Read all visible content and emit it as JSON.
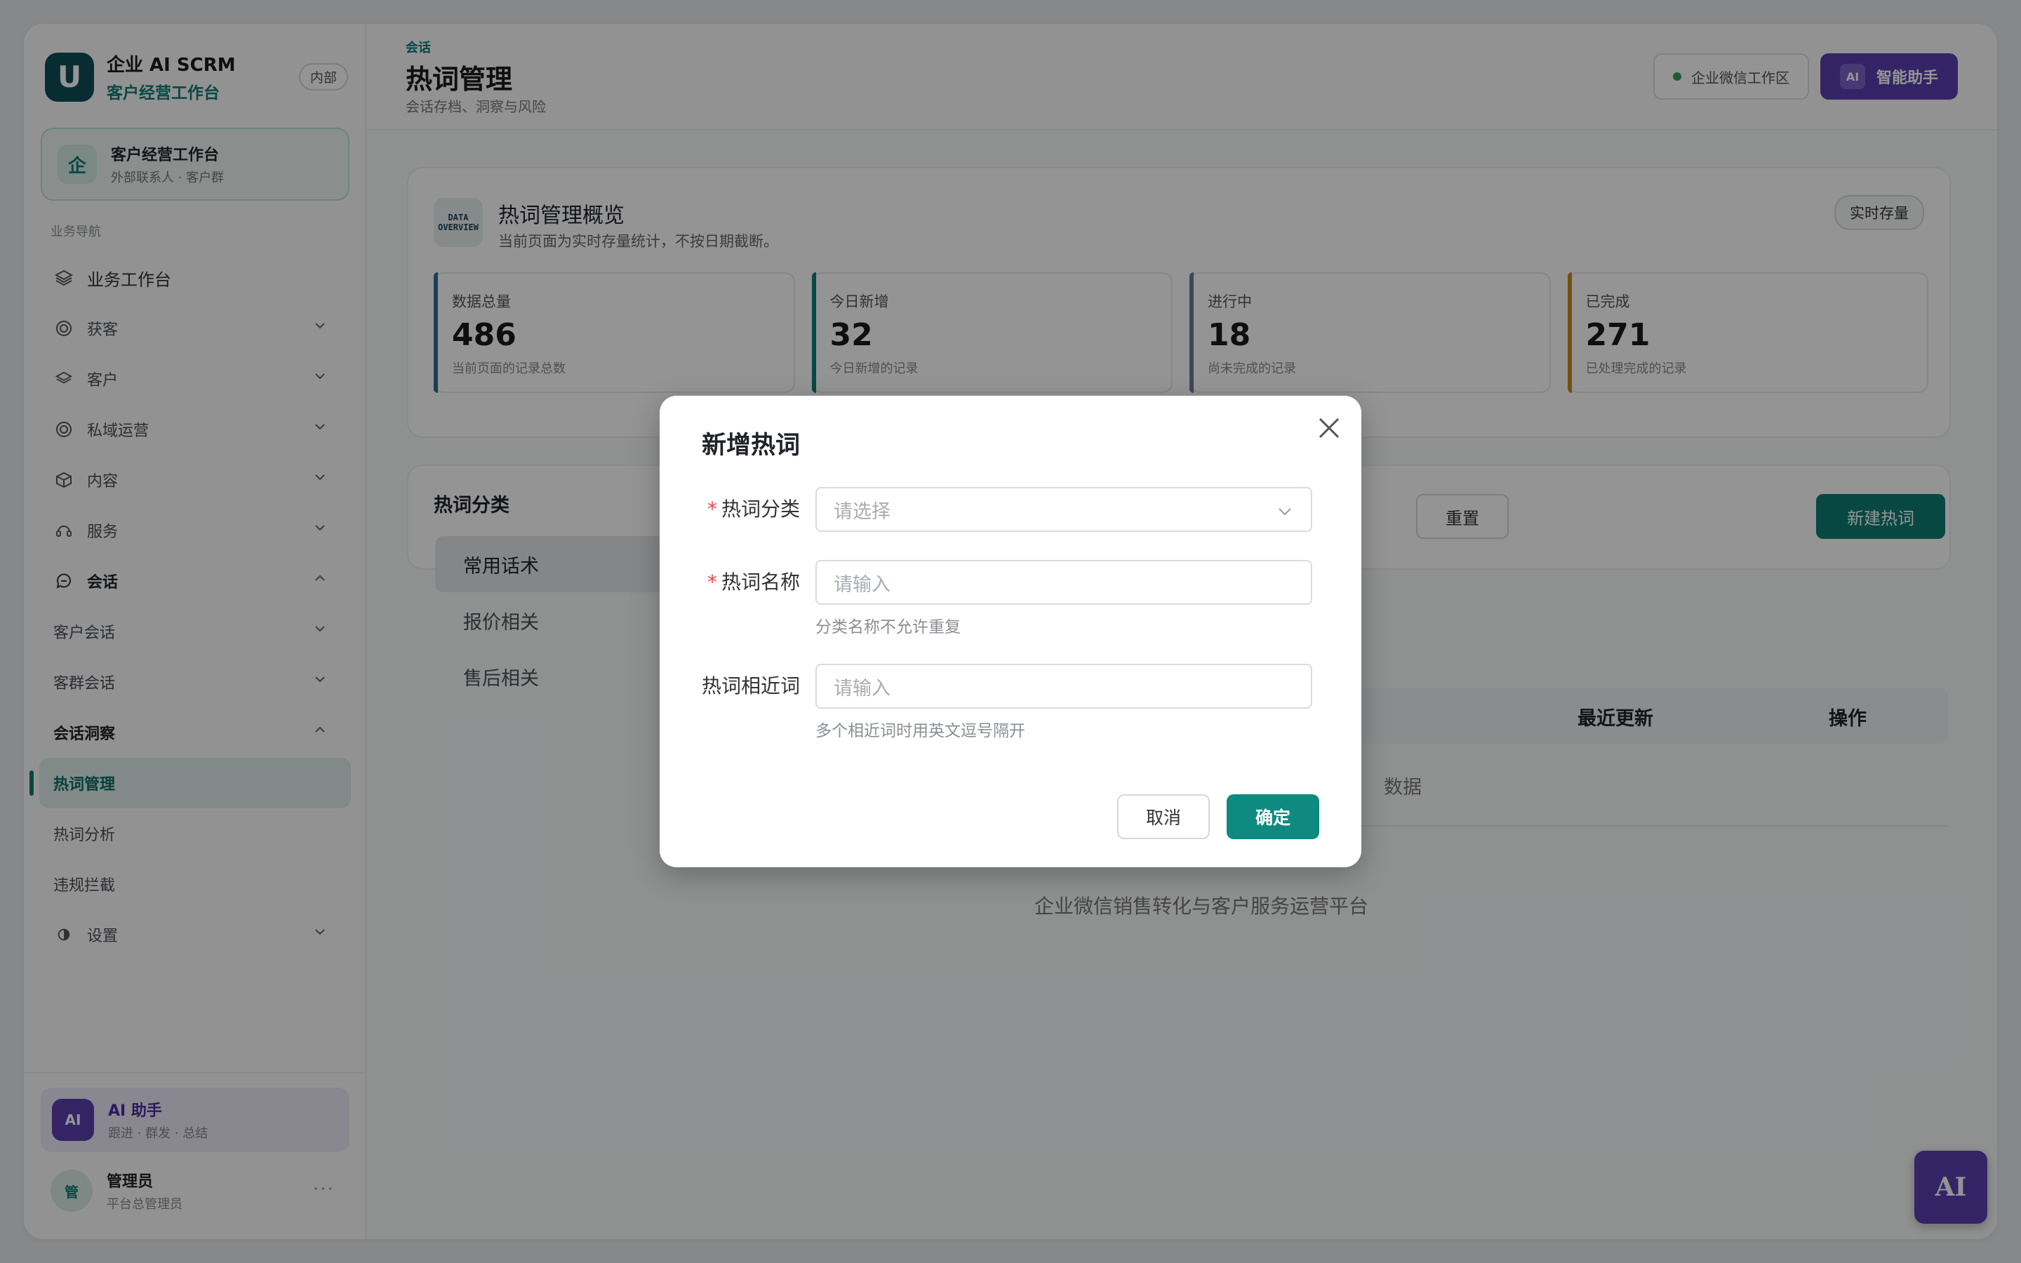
{
  "brand": {
    "logo": "U",
    "name": "企业 AI SCRM",
    "subtitle": "客户经营工作台",
    "badge": "内部"
  },
  "workspace": {
    "icon": "企",
    "title": "客户经营工作台",
    "subtitle": "外部联系人 · 客户群"
  },
  "sidebar": {
    "caption": "业务导航",
    "items": [
      {
        "label": "业务工作台",
        "icon": "layers-icon"
      },
      {
        "label": "获客",
        "icon": "target-icon"
      },
      {
        "label": "客户",
        "icon": "layers-icon"
      },
      {
        "label": "私域运营",
        "icon": "target-icon"
      },
      {
        "label": "内容",
        "icon": "box-icon"
      },
      {
        "label": "服务",
        "icon": "headset-icon"
      },
      {
        "label": "会话",
        "icon": "chat-icon"
      },
      {
        "label": "客户会话"
      },
      {
        "label": "客群会话"
      },
      {
        "label": "会话洞察"
      },
      {
        "label": "热词管理"
      },
      {
        "label": "热词分析"
      },
      {
        "label": "违规拦截"
      },
      {
        "label": "设置",
        "icon": "settings-icon"
      }
    ]
  },
  "assistant_card": {
    "avatar": "AI",
    "title": "AI 助手",
    "subtitle": "跟进 · 群发 · 总结"
  },
  "user": {
    "avatar": "管",
    "name": "管理员",
    "role": "平台总管理员",
    "more": "···"
  },
  "header": {
    "breadcrumb": "会话",
    "title": "热词管理",
    "subtitle": "会话存档、洞察与风险",
    "env_label": "企业微信工作区",
    "assist_mini": "AI",
    "assist_label": "智能助手"
  },
  "overview": {
    "icon_text": "DATA OVERVIEW",
    "title": "热词管理概览",
    "subtitle": "当前页面为实时存量统计，不按日期截断。",
    "tag": "实时存量",
    "stats": [
      {
        "label": "数据总量",
        "value": "486",
        "desc": "当前页面的记录总数",
        "color": "#2b6f8f"
      },
      {
        "label": "今日新增",
        "value": "32",
        "desc": "今日新增的记录",
        "color": "#0e7c74"
      },
      {
        "label": "进行中",
        "value": "18",
        "desc": "尚未完成的记录",
        "color": "#6b7a99"
      },
      {
        "label": "已完成",
        "value": "271",
        "desc": "已处理完成的记录",
        "color": "#c98a1b"
      }
    ]
  },
  "categories": {
    "title": "热词分类",
    "items": [
      "常用话术",
      "报价相关",
      "售后相关"
    ]
  },
  "toolbar": {
    "reset": "重置",
    "new": "新建热词"
  },
  "table": {
    "col_updated": "最近更新",
    "col_actions": "操作",
    "empty": "数据"
  },
  "footer": "企业微信销售转化与客户服务运营平台",
  "fab": "AI",
  "modal": {
    "title": "新增热词",
    "category_label": "热词分类",
    "category_placeholder": "请选择",
    "name_label": "热词名称",
    "name_placeholder": "请输入",
    "name_hint": "分类名称不允许重复",
    "similar_label": "热词相近词",
    "similar_placeholder": "请输入",
    "similar_hint": "多个相近词时用英文逗号隔开",
    "required_mark": "*",
    "cancel": "取消",
    "confirm": "确定"
  }
}
